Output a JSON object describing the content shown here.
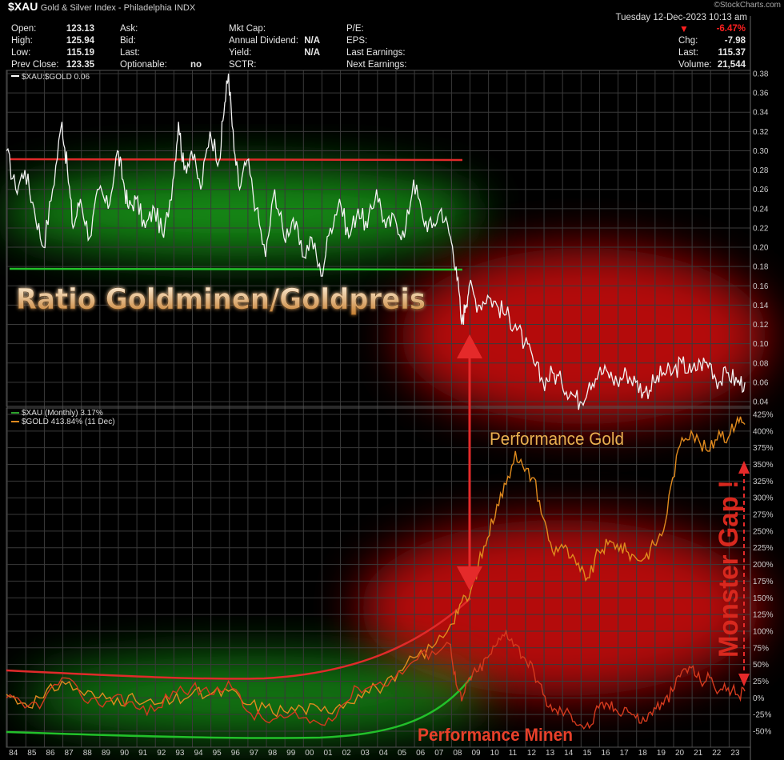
{
  "header": {
    "symbol": "$XAU",
    "description": "Gold & Silver Index - Philadelphia",
    "exchange": "INDX",
    "credit": "©StockCharts.com",
    "date": "Tuesday 12-Dec-2023 10:13 am",
    "col1": [
      {
        "label": "Open:",
        "value": "123.13"
      },
      {
        "label": "High:",
        "value": "125.94"
      },
      {
        "label": "Low:",
        "value": "115.19"
      },
      {
        "label": "Prev Close:",
        "value": "123.35"
      }
    ],
    "col2": [
      {
        "label": "Ask:",
        "value": ""
      },
      {
        "label": "Bid:",
        "value": ""
      },
      {
        "label": "Last:",
        "value": ""
      },
      {
        "label": "Optionable:",
        "value": "no"
      }
    ],
    "col3": [
      {
        "label": "Mkt Cap:",
        "value": ""
      },
      {
        "label": "Annual Dividend:",
        "value": "N/A"
      },
      {
        "label": "Yield:",
        "value": "N/A"
      },
      {
        "label": "SCTR:",
        "value": ""
      }
    ],
    "col4": [
      {
        "label": "P/E:",
        "value": ""
      },
      {
        "label": "EPS:",
        "value": ""
      },
      {
        "label": "Last Earnings:",
        "value": ""
      },
      {
        "label": "Next Earnings:",
        "value": ""
      }
    ],
    "col5": [
      {
        "label": "",
        "value": "-6.47%"
      },
      {
        "label": "Chg:",
        "value": "-7.98"
      },
      {
        "label": "Last:",
        "value": "115.37"
      },
      {
        "label": "Volume:",
        "value": "21,544"
      }
    ],
    "down_color": "#ff2020"
  },
  "chart_data": [
    {
      "type": "line",
      "legend": "$XAU:$GOLD 0.06",
      "annotation": "Ratio Goldminen/Goldpreis",
      "ylim": [
        0.04,
        0.38
      ],
      "yticks": [
        0.04,
        0.06,
        0.08,
        0.1,
        0.12,
        0.14,
        0.16,
        0.18,
        0.2,
        0.22,
        0.24,
        0.26,
        0.28,
        0.3,
        0.32,
        0.34,
        0.36,
        0.38
      ],
      "ytick_labels": [
        "0.04",
        "0.06",
        "0.08",
        "0.10",
        "0.12",
        "0.14",
        "0.16",
        "0.18",
        "0.20",
        "0.22",
        "0.24",
        "0.26",
        "0.28",
        "0.30",
        "0.32",
        "0.34",
        "0.36",
        "0.38"
      ],
      "x": [
        1984.0,
        1984.5,
        1985.0,
        1985.5,
        1986.0,
        1986.5,
        1987.0,
        1987.3,
        1987.6,
        1988.0,
        1988.5,
        1989.0,
        1989.5,
        1990.0,
        1990.3,
        1990.6,
        1991.0,
        1991.5,
        1992.0,
        1992.5,
        1993.0,
        1993.3,
        1993.6,
        1994.0,
        1994.5,
        1995.0,
        1995.5,
        1995.8,
        1996.0,
        1996.3,
        1996.6,
        1997.0,
        1997.5,
        1998.0,
        1998.5,
        1999.0,
        1999.5,
        2000.0,
        2000.5,
        2001.0,
        2001.5,
        2002.0,
        2002.5,
        2003.0,
        2003.5,
        2004.0,
        2004.5,
        2005.0,
        2005.5,
        2006.0,
        2006.5,
        2007.0,
        2007.5,
        2008.0,
        2008.3,
        2008.6,
        2008.8,
        2009.0,
        2009.5,
        2010.0,
        2010.5,
        2011.0,
        2011.5,
        2012.0,
        2012.5,
        2013.0,
        2013.5,
        2014.0,
        2014.5,
        2015.0,
        2015.5,
        2016.0,
        2016.5,
        2017.0,
        2017.5,
        2018.0,
        2018.5,
        2019.0,
        2019.5,
        2020.0,
        2020.5,
        2021.0,
        2021.5,
        2022.0,
        2022.5,
        2023.0,
        2023.5,
        2023.9
      ],
      "values": [
        0.3,
        0.26,
        0.28,
        0.24,
        0.2,
        0.26,
        0.33,
        0.28,
        0.22,
        0.25,
        0.21,
        0.26,
        0.24,
        0.3,
        0.27,
        0.24,
        0.25,
        0.22,
        0.24,
        0.21,
        0.27,
        0.33,
        0.28,
        0.3,
        0.26,
        0.32,
        0.29,
        0.35,
        0.38,
        0.3,
        0.26,
        0.29,
        0.24,
        0.19,
        0.26,
        0.21,
        0.23,
        0.19,
        0.21,
        0.17,
        0.22,
        0.25,
        0.21,
        0.24,
        0.22,
        0.26,
        0.22,
        0.23,
        0.21,
        0.27,
        0.23,
        0.22,
        0.24,
        0.21,
        0.18,
        0.12,
        0.14,
        0.16,
        0.14,
        0.15,
        0.14,
        0.13,
        0.12,
        0.1,
        0.08,
        0.06,
        0.07,
        0.06,
        0.05,
        0.04,
        0.06,
        0.07,
        0.07,
        0.06,
        0.07,
        0.06,
        0.05,
        0.06,
        0.07,
        0.07,
        0.08,
        0.07,
        0.08,
        0.08,
        0.06,
        0.07,
        0.06,
        0.06
      ]
    },
    {
      "type": "line",
      "legend": [
        "$XAU (Monthly) 3.17%",
        "$GOLD 413.84% (11 Dec)"
      ],
      "annotations": [
        "Performance Gold",
        "Performance Minen",
        "Monster Gap !"
      ],
      "ylim": [
        -50,
        425
      ],
      "ytick_labels": [
        "-50%",
        "-25%",
        "0%",
        "25%",
        "50%",
        "75%",
        "100%",
        "125%",
        "150%",
        "175%",
        "200%",
        "225%",
        "250%",
        "275%",
        "300%",
        "325%",
        "350%",
        "375%",
        "400%",
        "425%"
      ],
      "yticks": [
        -50,
        -25,
        0,
        25,
        50,
        75,
        100,
        125,
        150,
        175,
        200,
        225,
        250,
        275,
        300,
        325,
        350,
        375,
        400,
        425
      ],
      "series": [
        {
          "name": "$GOLD",
          "color": "#e08a1e",
          "x": [
            1984.0,
            1985.0,
            1986.0,
            1987.0,
            1988.0,
            1989.0,
            1990.0,
            1991.0,
            1992.0,
            1993.0,
            1994.0,
            1995.0,
            1996.0,
            1997.0,
            1998.0,
            1999.0,
            2000.0,
            2001.0,
            2002.0,
            2003.0,
            2004.0,
            2005.0,
            2006.0,
            2007.0,
            2008.0,
            2008.5,
            2009.0,
            2009.5,
            2010.0,
            2010.5,
            2011.0,
            2011.5,
            2012.0,
            2012.5,
            2013.0,
            2013.5,
            2014.0,
            2014.5,
            2015.0,
            2015.5,
            2016.0,
            2016.5,
            2017.0,
            2017.5,
            2018.0,
            2018.5,
            2019.0,
            2019.5,
            2020.0,
            2020.5,
            2021.0,
            2021.5,
            2022.0,
            2022.5,
            2023.0,
            2023.5,
            2023.9
          ],
          "values": [
            5,
            -8,
            0,
            25,
            10,
            0,
            0,
            -5,
            -10,
            -5,
            5,
            5,
            10,
            -10,
            -15,
            -20,
            -15,
            -20,
            -10,
            5,
            15,
            25,
            60,
            75,
            110,
            140,
            150,
            200,
            240,
            290,
            320,
            370,
            340,
            330,
            270,
            220,
            230,
            210,
            190,
            180,
            220,
            230,
            230,
            220,
            210,
            210,
            230,
            250,
            330,
            390,
            400,
            380,
            370,
            400,
            390,
            420,
            410
          ]
        },
        {
          "name": "$XAU",
          "color": "#d43a1e",
          "x": [
            1984.0,
            1985.0,
            1986.0,
            1987.0,
            1988.0,
            1989.0,
            1990.0,
            1991.0,
            1992.0,
            1993.0,
            1994.0,
            1995.0,
            1996.0,
            1997.0,
            1998.0,
            1999.0,
            2000.0,
            2001.0,
            2002.0,
            2003.0,
            2004.0,
            2005.0,
            2006.0,
            2007.0,
            2008.0,
            2008.3,
            2008.6,
            2009.0,
            2009.5,
            2010.0,
            2010.5,
            2011.0,
            2011.5,
            2012.0,
            2012.5,
            2013.0,
            2013.5,
            2014.0,
            2014.5,
            2015.0,
            2015.5,
            2016.0,
            2016.5,
            2017.0,
            2017.5,
            2018.0,
            2018.5,
            2019.0,
            2019.5,
            2020.0,
            2020.5,
            2021.0,
            2021.5,
            2022.0,
            2022.5,
            2023.0,
            2023.5,
            2023.9
          ],
          "values": [
            0,
            -15,
            -5,
            30,
            5,
            -10,
            5,
            -15,
            -20,
            10,
            15,
            5,
            25,
            -20,
            -35,
            -30,
            -30,
            -40,
            -15,
            15,
            20,
            30,
            55,
            70,
            80,
            20,
            -5,
            30,
            40,
            60,
            80,
            100,
            80,
            60,
            40,
            5,
            -20,
            -20,
            -25,
            -40,
            -45,
            -15,
            -10,
            -20,
            -15,
            -30,
            -35,
            -15,
            -10,
            10,
            40,
            45,
            25,
            30,
            10,
            15,
            5,
            10
          ]
        }
      ]
    }
  ],
  "x_axis": {
    "labels": [
      "84",
      "85",
      "86",
      "87",
      "88",
      "89",
      "90",
      "91",
      "92",
      "93",
      "94",
      "95",
      "96",
      "97",
      "98",
      "99",
      "00",
      "01",
      "02",
      "03",
      "04",
      "05",
      "06",
      "07",
      "08",
      "09",
      "10",
      "11",
      "12",
      "13",
      "14",
      "15",
      "16",
      "17",
      "18",
      "19",
      "20",
      "21",
      "22",
      "23"
    ],
    "start_year": 1984
  }
}
